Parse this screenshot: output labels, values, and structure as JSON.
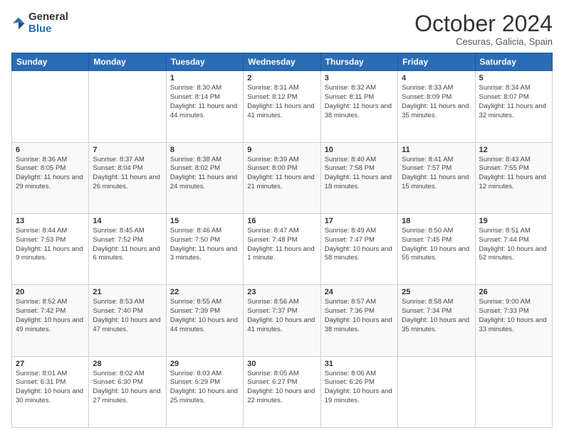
{
  "header": {
    "logo_general": "General",
    "logo_blue": "Blue",
    "month_title": "October 2024",
    "location": "Cesuras, Galicia, Spain"
  },
  "days_of_week": [
    "Sunday",
    "Monday",
    "Tuesday",
    "Wednesday",
    "Thursday",
    "Friday",
    "Saturday"
  ],
  "weeks": [
    [
      {
        "day": "",
        "info": ""
      },
      {
        "day": "",
        "info": ""
      },
      {
        "day": "1",
        "info": "Sunrise: 8:30 AM\nSunset: 8:14 PM\nDaylight: 11 hours and 44 minutes."
      },
      {
        "day": "2",
        "info": "Sunrise: 8:31 AM\nSunset: 8:12 PM\nDaylight: 11 hours and 41 minutes."
      },
      {
        "day": "3",
        "info": "Sunrise: 8:32 AM\nSunset: 8:11 PM\nDaylight: 11 hours and 38 minutes."
      },
      {
        "day": "4",
        "info": "Sunrise: 8:33 AM\nSunset: 8:09 PM\nDaylight: 11 hours and 35 minutes."
      },
      {
        "day": "5",
        "info": "Sunrise: 8:34 AM\nSunset: 8:07 PM\nDaylight: 11 hours and 32 minutes."
      }
    ],
    [
      {
        "day": "6",
        "info": "Sunrise: 8:36 AM\nSunset: 8:05 PM\nDaylight: 11 hours and 29 minutes."
      },
      {
        "day": "7",
        "info": "Sunrise: 8:37 AM\nSunset: 8:04 PM\nDaylight: 11 hours and 26 minutes."
      },
      {
        "day": "8",
        "info": "Sunrise: 8:38 AM\nSunset: 8:02 PM\nDaylight: 11 hours and 24 minutes."
      },
      {
        "day": "9",
        "info": "Sunrise: 8:39 AM\nSunset: 8:00 PM\nDaylight: 11 hours and 21 minutes."
      },
      {
        "day": "10",
        "info": "Sunrise: 8:40 AM\nSunset: 7:58 PM\nDaylight: 11 hours and 18 minutes."
      },
      {
        "day": "11",
        "info": "Sunrise: 8:41 AM\nSunset: 7:57 PM\nDaylight: 11 hours and 15 minutes."
      },
      {
        "day": "12",
        "info": "Sunrise: 8:43 AM\nSunset: 7:55 PM\nDaylight: 11 hours and 12 minutes."
      }
    ],
    [
      {
        "day": "13",
        "info": "Sunrise: 8:44 AM\nSunset: 7:53 PM\nDaylight: 11 hours and 9 minutes."
      },
      {
        "day": "14",
        "info": "Sunrise: 8:45 AM\nSunset: 7:52 PM\nDaylight: 11 hours and 6 minutes."
      },
      {
        "day": "15",
        "info": "Sunrise: 8:46 AM\nSunset: 7:50 PM\nDaylight: 11 hours and 3 minutes."
      },
      {
        "day": "16",
        "info": "Sunrise: 8:47 AM\nSunset: 7:48 PM\nDaylight: 11 hours and 1 minute."
      },
      {
        "day": "17",
        "info": "Sunrise: 8:49 AM\nSunset: 7:47 PM\nDaylight: 10 hours and 58 minutes."
      },
      {
        "day": "18",
        "info": "Sunrise: 8:50 AM\nSunset: 7:45 PM\nDaylight: 10 hours and 55 minutes."
      },
      {
        "day": "19",
        "info": "Sunrise: 8:51 AM\nSunset: 7:44 PM\nDaylight: 10 hours and 52 minutes."
      }
    ],
    [
      {
        "day": "20",
        "info": "Sunrise: 8:52 AM\nSunset: 7:42 PM\nDaylight: 10 hours and 49 minutes."
      },
      {
        "day": "21",
        "info": "Sunrise: 8:53 AM\nSunset: 7:40 PM\nDaylight: 10 hours and 47 minutes."
      },
      {
        "day": "22",
        "info": "Sunrise: 8:55 AM\nSunset: 7:39 PM\nDaylight: 10 hours and 44 minutes."
      },
      {
        "day": "23",
        "info": "Sunrise: 8:56 AM\nSunset: 7:37 PM\nDaylight: 10 hours and 41 minutes."
      },
      {
        "day": "24",
        "info": "Sunrise: 8:57 AM\nSunset: 7:36 PM\nDaylight: 10 hours and 38 minutes."
      },
      {
        "day": "25",
        "info": "Sunrise: 8:58 AM\nSunset: 7:34 PM\nDaylight: 10 hours and 35 minutes."
      },
      {
        "day": "26",
        "info": "Sunrise: 9:00 AM\nSunset: 7:33 PM\nDaylight: 10 hours and 33 minutes."
      }
    ],
    [
      {
        "day": "27",
        "info": "Sunrise: 8:01 AM\nSunset: 6:31 PM\nDaylight: 10 hours and 30 minutes."
      },
      {
        "day": "28",
        "info": "Sunrise: 8:02 AM\nSunset: 6:30 PM\nDaylight: 10 hours and 27 minutes."
      },
      {
        "day": "29",
        "info": "Sunrise: 8:03 AM\nSunset: 6:29 PM\nDaylight: 10 hours and 25 minutes."
      },
      {
        "day": "30",
        "info": "Sunrise: 8:05 AM\nSunset: 6:27 PM\nDaylight: 10 hours and 22 minutes."
      },
      {
        "day": "31",
        "info": "Sunrise: 8:06 AM\nSunset: 6:26 PM\nDaylight: 10 hours and 19 minutes."
      },
      {
        "day": "",
        "info": ""
      },
      {
        "day": "",
        "info": ""
      }
    ]
  ]
}
